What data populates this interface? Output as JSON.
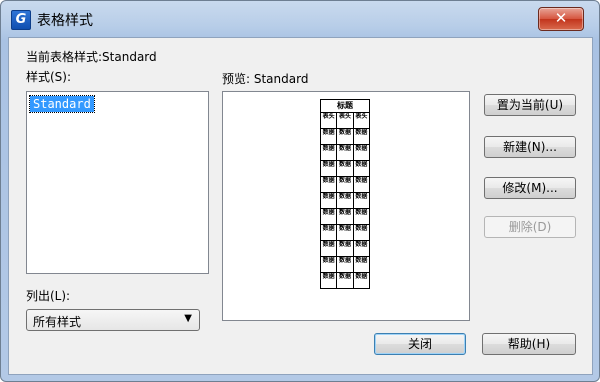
{
  "window": {
    "title": "表格样式",
    "app_icon": "G",
    "close_glyph": "✕"
  },
  "current_style": "当前表格样式:Standard",
  "styles_label": "样式(S):",
  "styles_list": [
    "Standard"
  ],
  "preview_label": "预览: Standard",
  "list_label": "列出(L):",
  "list_filter": {
    "selected": "所有样式"
  },
  "buttons": {
    "set_current": "置为当前(U)",
    "new": "新建(N)...",
    "modify": "修改(M)...",
    "delete": "删除(D)",
    "close": "关闭",
    "help": "帮助(H)"
  },
  "preview_table": {
    "title": "标题",
    "header": [
      "表头",
      "表头",
      "表头"
    ],
    "data_cell": "数据",
    "data_rows": 10
  },
  "colors": {
    "selection": "#3399ff",
    "titlebar": "#b7cde8",
    "close_button": "#c2341c"
  }
}
